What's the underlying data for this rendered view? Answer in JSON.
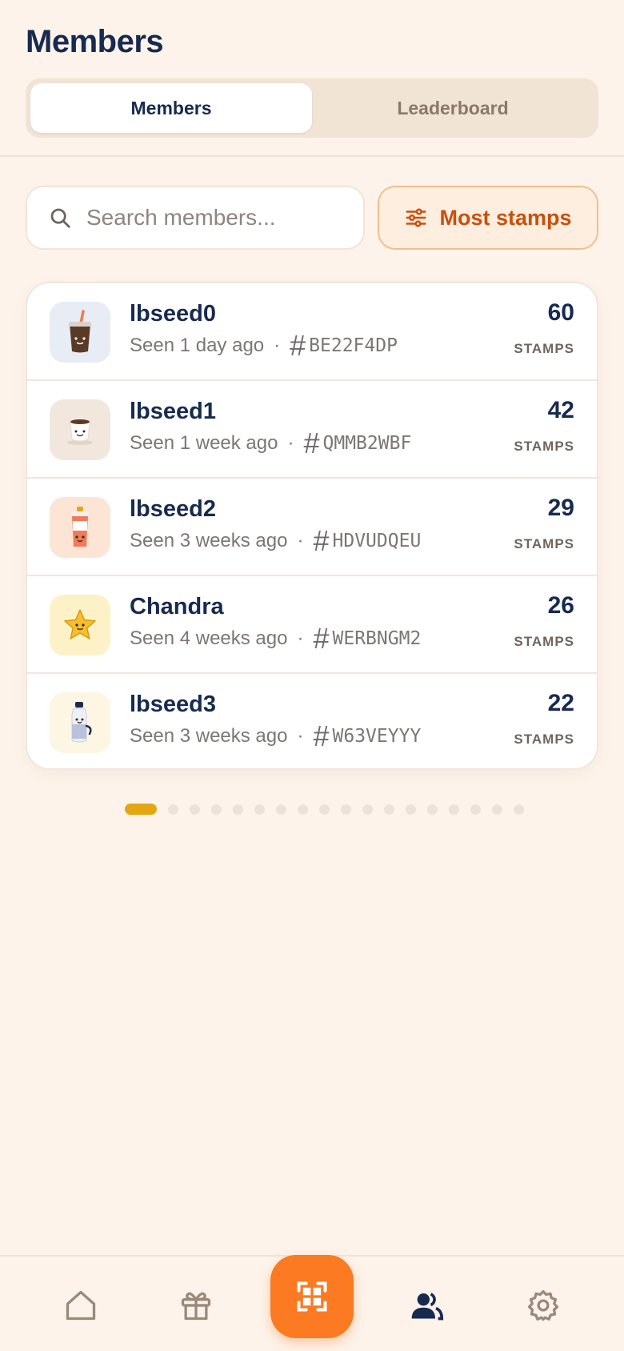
{
  "header": {
    "title": "Members"
  },
  "tabs": [
    {
      "label": "Members",
      "active": true
    },
    {
      "label": "Leaderboard",
      "active": false
    }
  ],
  "search": {
    "placeholder": "Search members...",
    "value": ""
  },
  "sort": {
    "label": "Most stamps",
    "icon": "sliders-icon"
  },
  "members": [
    {
      "name": "lbseed0",
      "seen": "Seen 1 day ago",
      "code": "BE22F4DP",
      "stamps": "60",
      "stamps_label": "STAMPS",
      "avatar": "iced-coffee-icon",
      "avatar_bg": "#e7ecf5"
    },
    {
      "name": "lbseed1",
      "seen": "Seen 1 week ago",
      "code": "QMMB2WBF",
      "stamps": "42",
      "stamps_label": "STAMPS",
      "avatar": "coffee-cup-icon",
      "avatar_bg": "#f2e7dc"
    },
    {
      "name": "lbseed2",
      "seen": "Seen 3 weeks ago",
      "code": "HDVUDQEU",
      "stamps": "29",
      "stamps_label": "STAMPS",
      "avatar": "takeaway-cup-icon",
      "avatar_bg": "#fde5d5"
    },
    {
      "name": "Chandra",
      "seen": "Seen 4 weeks ago",
      "code": "WERBNGM2",
      "stamps": "26",
      "stamps_label": "STAMPS",
      "avatar": "star-icon",
      "avatar_bg": "#fdf2c7"
    },
    {
      "name": "lbseed3",
      "seen": "Seen 3 weeks ago",
      "code": "W63VEYYY",
      "stamps": "22",
      "stamps_label": "STAMPS",
      "avatar": "milk-bottle-icon",
      "avatar_bg": "#fcf6e3"
    }
  ],
  "pagination": {
    "total_pages": 18,
    "current_page": 1
  },
  "bottom_nav": [
    {
      "name": "home",
      "icon": "home-icon",
      "active": false
    },
    {
      "name": "rewards",
      "icon": "gift-icon",
      "active": false
    },
    {
      "name": "scan",
      "icon": "qr-scan-icon",
      "active": false
    },
    {
      "name": "members",
      "icon": "users-icon",
      "active": true
    },
    {
      "name": "settings",
      "icon": "gear-icon",
      "active": false
    }
  ],
  "colors": {
    "accent": "#fb7a22",
    "sort_text": "#c8500d",
    "pager_active": "#e2a712",
    "title": "#172a4f",
    "background": "#fdf3ea"
  }
}
